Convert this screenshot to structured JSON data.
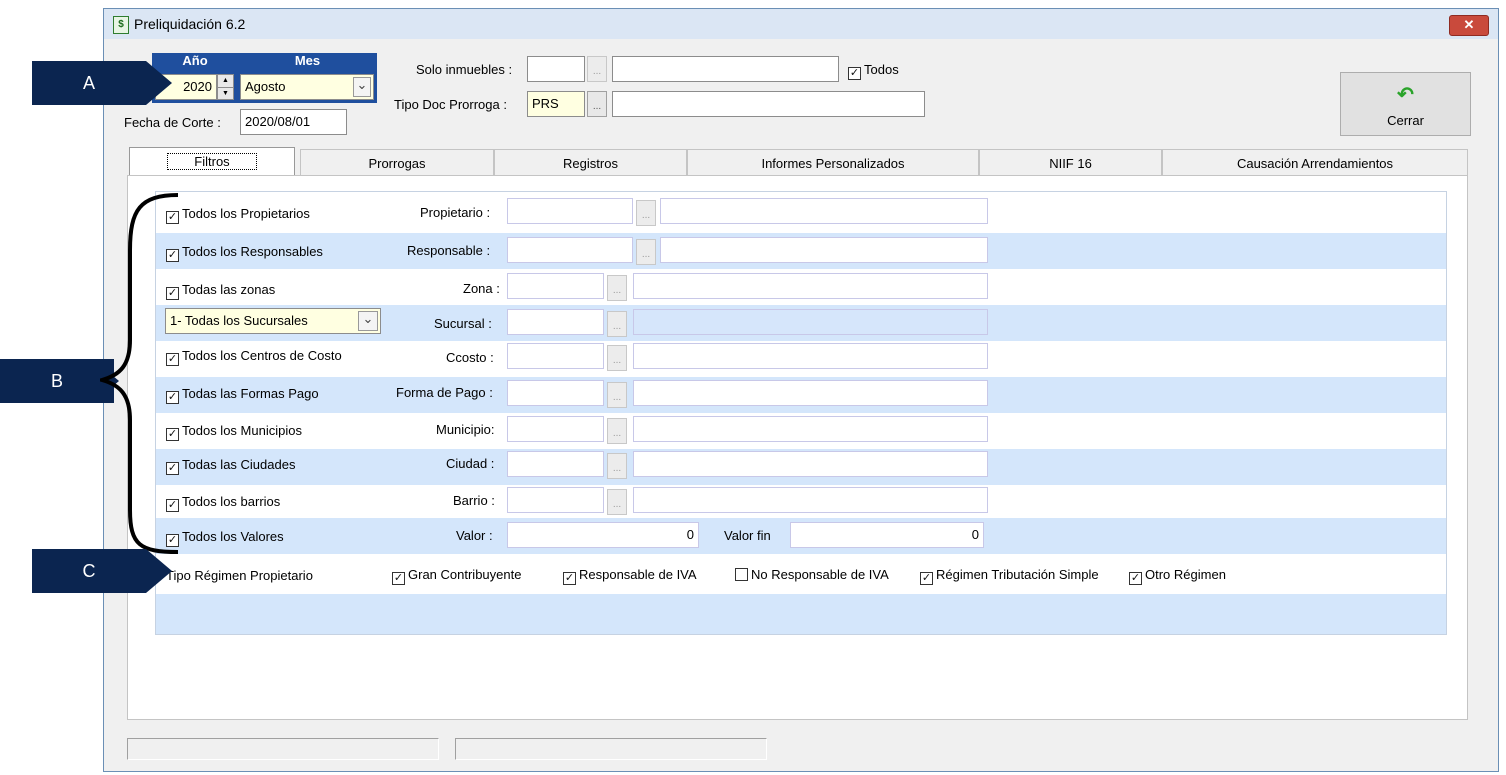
{
  "window": {
    "title": "Preliquidación 6.2",
    "close_glyph": "✕",
    "icon": "spreadsheet-icon"
  },
  "header": {
    "year_label": "Año",
    "month_label": "Mes",
    "year_value": "2020",
    "month_value": "Agosto",
    "cutoff_label": "Fecha de Corte :",
    "cutoff_value": "2020/08/01",
    "solo_inmuebles_label": "Solo inmuebles :",
    "solo_inmuebles_code": "",
    "solo_inmuebles_name": "",
    "todos_label": "Todos",
    "tipo_doc_label": "Tipo Doc Prorroga :",
    "tipo_doc_value": "PRS",
    "tipo_doc_name": "",
    "close_button": "Cerrar",
    "dots": "..."
  },
  "tabs": [
    {
      "label": "Filtros"
    },
    {
      "label": "Prorrogas"
    },
    {
      "label": "Registros"
    },
    {
      "label": "Informes Personalizados"
    },
    {
      "label": "NIIF 16"
    },
    {
      "label": "Causación Arrendamientos"
    }
  ],
  "filters": {
    "rows": [
      {
        "check_label": "Todos los Propietarios",
        "field_label": "Propietario :"
      },
      {
        "check_label": "Todos los Responsables",
        "field_label": "Responsable :"
      },
      {
        "check_label": "Todas las zonas",
        "field_label": "Zona :"
      },
      {
        "select_value": "1- Todas los Sucursales",
        "field_label": "Sucursal :"
      },
      {
        "check_label": "Todos los Centros de Costo",
        "field_label": "Ccosto :"
      },
      {
        "check_label": "Todas las Formas Pago",
        "field_label": "Forma de Pago :"
      },
      {
        "check_label": "Todos los Municipios",
        "field_label": "Municipio:"
      },
      {
        "check_label": "Todas las Ciudades",
        "field_label": "Ciudad :"
      },
      {
        "check_label": "Todos los barrios",
        "field_label": "Barrio :"
      },
      {
        "check_label": "Todos los Valores",
        "field_label": "Valor :",
        "value": "0",
        "value_end_label": "Valor fin",
        "value_end": "0"
      }
    ],
    "regimen": {
      "label": "Tipo Régimen Propietario",
      "options": [
        {
          "label": "Gran Contribuyente",
          "checked": "✓"
        },
        {
          "label": "Responsable de IVA",
          "checked": "✓"
        },
        {
          "label": "No Responsable de IVA",
          "checked": ""
        },
        {
          "label": "Régimen Tributación Simple",
          "checked": "✓"
        },
        {
          "label": "Otro Régimen",
          "checked": "✓"
        }
      ]
    }
  },
  "callouts": {
    "a": "A",
    "b": "B",
    "c": "C"
  },
  "glyphs": {
    "check": "✓",
    "chevron": "⌄",
    "spin_up": "▲",
    "spin_down": "▼",
    "undo": "↶"
  }
}
